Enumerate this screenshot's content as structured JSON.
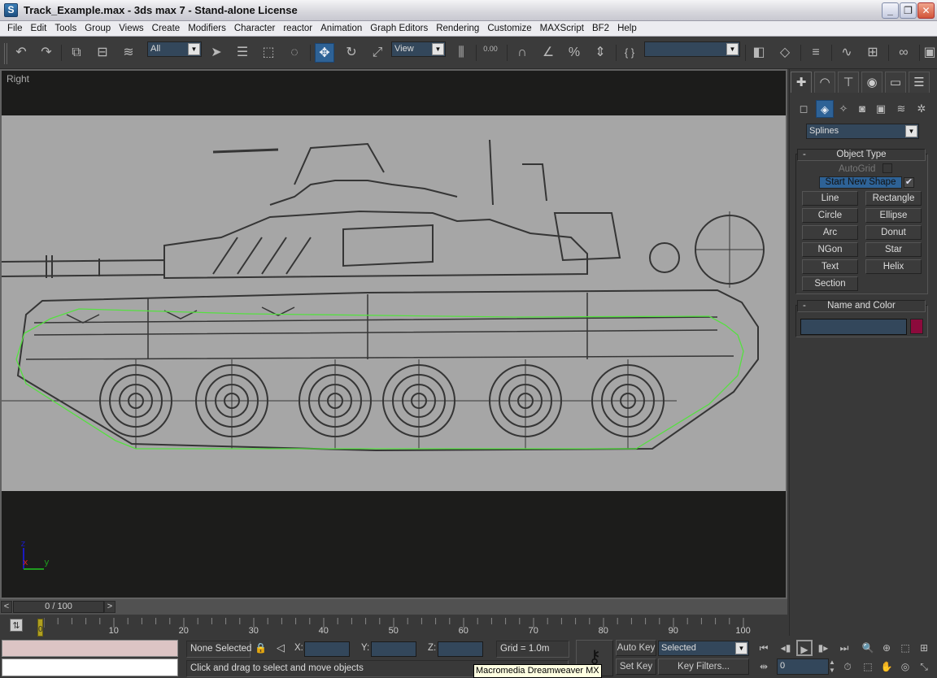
{
  "window": {
    "title": "Track_Example.max - 3ds max 7  - Stand-alone License",
    "app_icon_glyph": "S",
    "minimize_glyph": "_",
    "restore_glyph": "❐",
    "close_glyph": "✕"
  },
  "menu": [
    "File",
    "Edit",
    "Tools",
    "Group",
    "Views",
    "Create",
    "Modifiers",
    "Character",
    "reactor",
    "Animation",
    "Graph Editors",
    "Rendering",
    "Customize",
    "MAXScript",
    "BF2",
    "Help"
  ],
  "toolbar": {
    "undo_glyph": "↶",
    "redo_glyph": "↷",
    "link_glyph": "⧉",
    "unlink_glyph": "⊟",
    "bind_space_warp_glyph": "≋",
    "selection_filter": "All",
    "select_object_glyph": "➤",
    "select_by_name_glyph": "☰",
    "rect_region_glyph": "⬚",
    "window_crossing_glyph": "◌",
    "move_glyph": "✥",
    "rotate_glyph": "↻",
    "scale_glyph": "⤢",
    "ref_coord_system": "View",
    "pivot_glyph": "⫼",
    "manipulate_label": "0.00",
    "snap_3_glyph": "∩",
    "angle_snap_glyph": "∠",
    "percent_snap_glyph": "%",
    "spinner_snap_glyph": "⇕",
    "named_sel_glyph": "{ }",
    "named_selection_set": "",
    "mirror_glyph": "◧",
    "align_glyph": "◇",
    "layers_glyph": "≡",
    "curve_editor_glyph": "∿",
    "schematic_glyph": "⊞",
    "material_editor_glyph": "∞"
  },
  "viewport": {
    "label": "Right",
    "axis_labels": {
      "z": "z",
      "x": "x",
      "y": "y"
    },
    "spline_color": "#55e040",
    "axis_colors": {
      "z": "#1a1ac0",
      "x": "#d02020",
      "y": "#1f9a1f"
    }
  },
  "time_slider": {
    "prev_glyph": "<",
    "next_glyph": ">",
    "position": "0 / 100",
    "current_frame": 0,
    "total_frames": 100
  },
  "trackbar": {
    "ticks": [
      "0",
      "10",
      "20",
      "30",
      "40",
      "50",
      "60",
      "70",
      "80",
      "90",
      "100"
    ],
    "toggle_glyph": "⇅"
  },
  "status": {
    "selection": "None Selected",
    "lock_glyph": "🔒",
    "transform_glyph": "◁",
    "x_label": "X:",
    "y_label": "Y:",
    "z_label": "Z:",
    "x_value": "",
    "y_value": "",
    "z_value": "",
    "grid": "Grid = 1.0m",
    "prompt": "Click and drag to select and move objects",
    "key_glyph": "⚷",
    "auto_key": "Auto Key",
    "set_key": "Set Key",
    "key_mode": "Selected",
    "key_filters": "Key Filters...",
    "frame_field": "0",
    "tooltip": "Macromedia Dreamweaver MX"
  },
  "playback": {
    "goto_start": "⏮",
    "prev_frame": "◂▮",
    "play": "▶",
    "next_frame": "▮▸",
    "goto_end": "⏭",
    "key_mode_toggle": "⇹",
    "time_config": "⏱"
  },
  "nav_controls": {
    "zoom": "🔍",
    "zoom_all": "⊕",
    "zoom_extents": "⬚",
    "zoom_extents_all": "⊞",
    "region_zoom": "⬚",
    "pan": "✋",
    "arc_rotate": "◎",
    "maximize": "⤡"
  },
  "command_panel": {
    "tabs": [
      {
        "name": "create",
        "glyph": "✚"
      },
      {
        "name": "modify",
        "glyph": "◠"
      },
      {
        "name": "hierarchy",
        "glyph": "⊤"
      },
      {
        "name": "motion",
        "glyph": "◉"
      },
      {
        "name": "display",
        "glyph": "▭"
      },
      {
        "name": "utilities",
        "glyph": "☰"
      }
    ],
    "subtabs": [
      {
        "name": "geometry",
        "glyph": "◻"
      },
      {
        "name": "shapes",
        "glyph": "◈"
      },
      {
        "name": "lights",
        "glyph": "✧"
      },
      {
        "name": "cameras",
        "glyph": "◙"
      },
      {
        "name": "helpers",
        "glyph": "▣"
      },
      {
        "name": "space-warps",
        "glyph": "≋"
      },
      {
        "name": "systems",
        "glyph": "✲"
      }
    ],
    "category": "Splines",
    "object_type": {
      "title": "Object Type",
      "collapse_glyph": "-",
      "autogrid_label": "AutoGrid",
      "autogrid_checked": false,
      "start_new_shape_label": "Start New Shape",
      "start_new_shape_checked": true,
      "buttons": [
        "Line",
        "Rectangle",
        "Circle",
        "Ellipse",
        "Arc",
        "Donut",
        "NGon",
        "Star",
        "Text",
        "Helix",
        "Section"
      ]
    },
    "name_and_color": {
      "title": "Name and Color",
      "collapse_glyph": "-",
      "name_value": "",
      "color": "#8c0a3c"
    }
  }
}
